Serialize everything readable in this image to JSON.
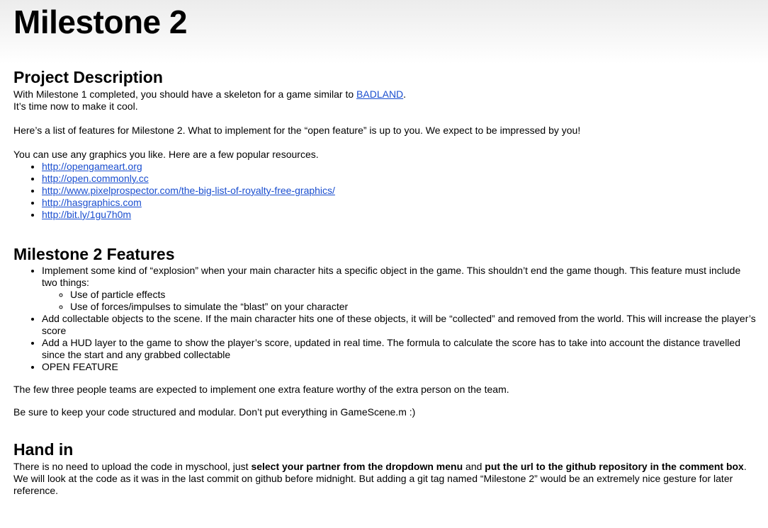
{
  "title": "Milestone 2",
  "project_description": {
    "heading": "Project Description",
    "intro_before_link": "With Milestone 1 completed, you should have a skeleton for a game similar to ",
    "intro_link": "BADLAND",
    "intro_after_link": ".",
    "intro_line2": "It’s time now to make it cool.",
    "features_text": "Here’s a list of features for Milestone 2. What to implement for the “open feature” is up to you. We expect to be impressed by you!",
    "graphics_text": "You can use any graphics you like. Here are a few popular resources.",
    "resources": [
      "http://opengameart.org",
      "http://open.commonly.cc",
      "http://www.pixelprospector.com/the-big-list-of-royalty-free-graphics/",
      "http://hasgraphics.com",
      "http://bit.ly/1gu7h0m"
    ]
  },
  "features": {
    "heading": "Milestone 2 Features",
    "item1": "Implement some kind of “explosion” when your main character hits a specific object in the game. This shouldn’t end the game though. This feature must include two things:",
    "item1_sub": [
      "Use of particle effects",
      "Use of forces/impulses to simulate the “blast” on your character"
    ],
    "item2": "Add collectable objects to the scene. If the main character hits one of these objects, it will be “collected” and removed from the world. This will increase the player’s score",
    "item3": "Add a HUD layer to the game to show the player’s score, updated in real time. The formula to calculate the score has to take into account the distance travelled since the start and any grabbed collectable",
    "item4": "OPEN FEATURE",
    "teams_text": "The few three people teams are expected to implement one extra feature worthy of the extra person on the team.",
    "code_text": "Be sure to keep your code structured and modular. Don’t put everything in GameScene.m :)"
  },
  "hand_in": {
    "heading": "Hand in",
    "text_part1": "There is no need to upload the code in myschool, just ",
    "bold1": "select your partner from the dropdown menu",
    "text_part2": " and ",
    "bold2": "put the url to the github repository in the comment box",
    "text_part3": ".",
    "line2": "We will look at the code as it was in the last commit on github before midnight. But adding a git tag named “Milestone 2” would be an extremely nice gesture for later reference."
  }
}
